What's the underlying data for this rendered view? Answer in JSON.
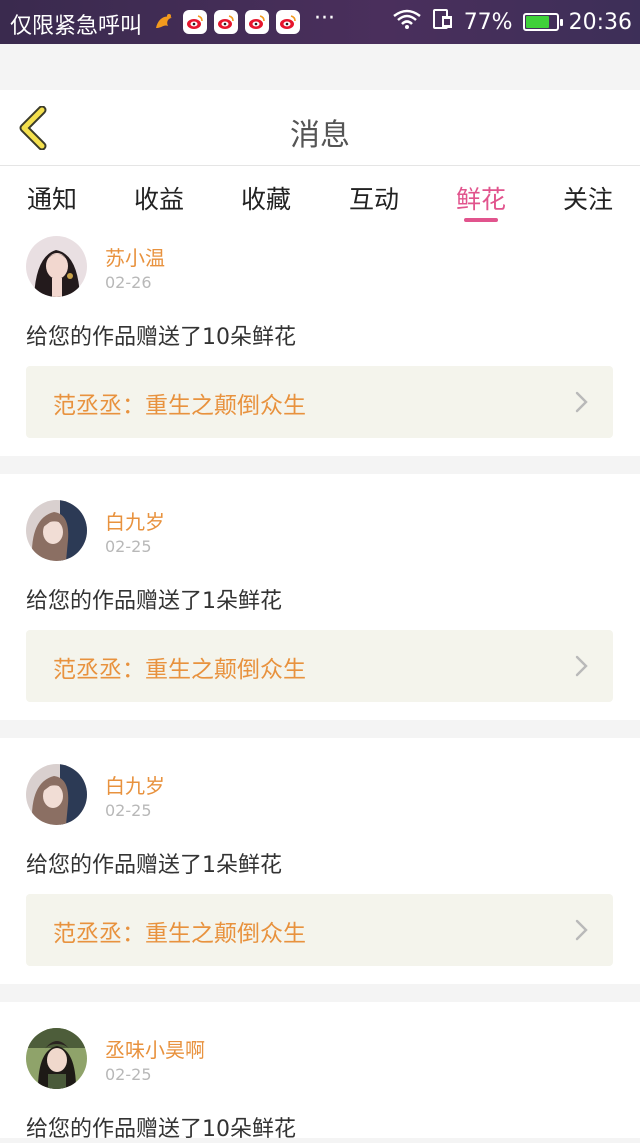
{
  "status_bar": {
    "carrier": "仅限紧急呼叫",
    "dots": "···",
    "battery_percent": "77%",
    "battery_level": 0.77,
    "time": "20:36",
    "notification_icons": [
      "uc-browser-icon",
      "weibo-icon",
      "weibo-icon",
      "weibo-icon",
      "weibo-icon"
    ]
  },
  "header": {
    "title": "消息"
  },
  "tabs": [
    {
      "label": "通知",
      "active": false
    },
    {
      "label": "收益",
      "active": false
    },
    {
      "label": "收藏",
      "active": false
    },
    {
      "label": "互动",
      "active": false
    },
    {
      "label": "鲜花",
      "active": true
    },
    {
      "label": "关注",
      "active": false
    }
  ],
  "colors": {
    "accent": "#e1548d",
    "orange": "#e8923e"
  },
  "messages": [
    {
      "username": "苏小温",
      "date": "02-26",
      "text": "给您的作品赠送了10朵鲜花",
      "work": "范丞丞：重生之颠倒众生"
    },
    {
      "username": "白九岁",
      "date": "02-25",
      "text": "给您的作品赠送了1朵鲜花",
      "work": "范丞丞：重生之颠倒众生"
    },
    {
      "username": "白九岁",
      "date": "02-25",
      "text": "给您的作品赠送了1朵鲜花",
      "work": "范丞丞：重生之颠倒众生"
    },
    {
      "username": "丞味小昊啊",
      "date": "02-25",
      "text": "给您的作品赠送了10朵鲜花"
    }
  ]
}
